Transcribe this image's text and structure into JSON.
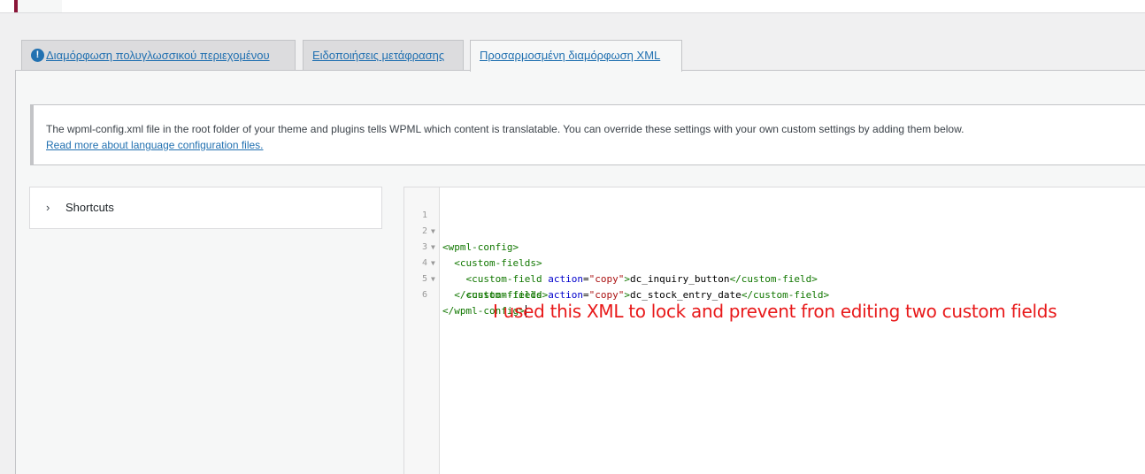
{
  "tabs": [
    {
      "label": "Διαμόρφωση πολυγλωσσικού περιεχομένου",
      "icon": "info-icon",
      "active": false
    },
    {
      "label": "Ειδοποιήσεις μετάφρασης",
      "active": false
    },
    {
      "label": "Προσαρμοσμένη διαμόρφωση XML",
      "active": true
    }
  ],
  "notice": {
    "text": "The wpml-config.xml file in the root folder of your theme and plugins tells WPML which content is translatable. You can override these settings with your own custom settings by adding them below.",
    "link": "Read more about language configuration files."
  },
  "shortcuts": {
    "label": "Shortcuts",
    "icon": "chevron-right-icon"
  },
  "editor": {
    "lines": [
      {
        "num": "1",
        "fold": true
      },
      {
        "num": "2",
        "fold": true
      },
      {
        "num": "3",
        "fold": true
      },
      {
        "num": "4",
        "fold": true
      },
      {
        "num": "5",
        "fold": false
      },
      {
        "num": "6",
        "fold": false
      }
    ],
    "tokens": {
      "l1_open": "<wpml-config>",
      "l2_open": "<custom-fields>",
      "l3_tag": "<custom-field",
      "l3_attr": "action",
      "l3_eq": "=",
      "l3_str": "\"copy\"",
      "l3_close": ">",
      "l3_value": "dc_inquiry_button",
      "l3_end": "</custom-field>",
      "l4_tag": "<custom-field",
      "l4_attr": "action",
      "l4_eq": "=",
      "l4_str": "\"copy\"",
      "l4_close": ">",
      "l4_value": "dc_stock_entry_date",
      "l4_end": "</custom-field>",
      "l5_close": "</custom-fields>",
      "l6_close": "</wpml-config>"
    }
  },
  "annotation": "I used this XML to lock and prevent fron editing two custom fields",
  "colors": {
    "accent": "#8a1538",
    "link": "#2271b1",
    "annotation": "#e8191a"
  }
}
